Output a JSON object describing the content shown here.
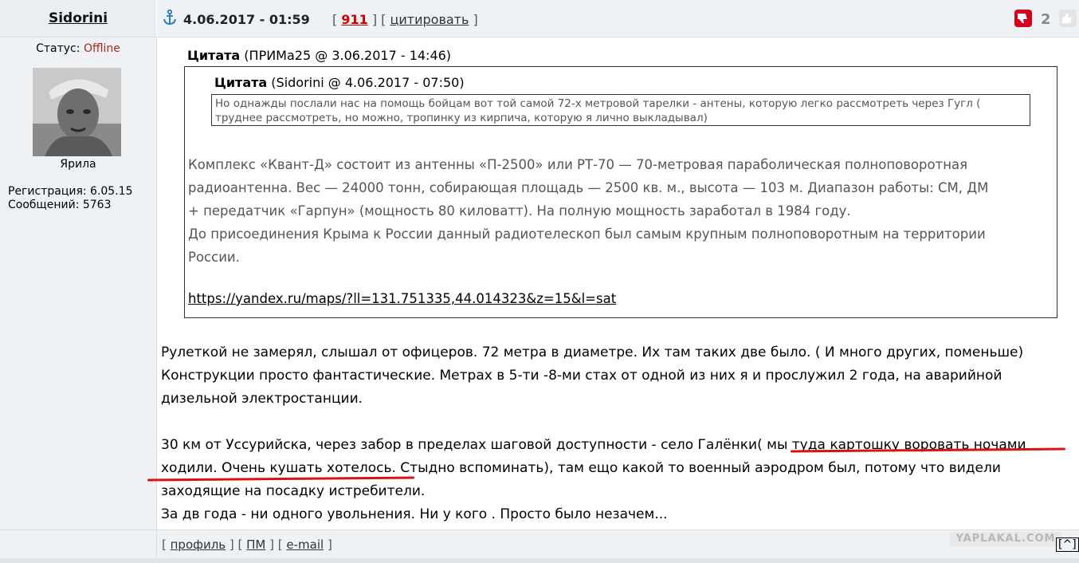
{
  "header": {
    "username": "Sidorini",
    "date": "4.06.2017 - 01:59",
    "bracket_open": "[ ",
    "post_number": "911",
    "bracket_mid": " ] [ ",
    "cite_label": "цитировать",
    "bracket_close": " ]",
    "rating": "2"
  },
  "sidebar": {
    "status_label": "Статус: ",
    "status_value": "Offline",
    "avatar_caption": "Ярила",
    "registration": "Регистрация: 6.05.15",
    "messages": "Сообщений: 5763"
  },
  "quote_outer": {
    "label": "Цитата",
    "meta": " (ПРИМа25 @ 3.06.2017 - 14:46)",
    "text_lines": [
      "Комплекс «Квант-Д» состоит из антенны «П-2500» или РТ-70 — 70-метровая параболическая полноповоротная",
      "радиоантенна. Вес — 24000 тонн, собирающая площадь — 2500 кв. м., высота — 103 м. Диапазон работы: СМ, ДМ",
      "+ передатчик «Гарпун» (мощность 80 киловатт). На полную мощность заработал в 1984 году.",
      "До присоединения Крыма к России данный радиотелескоп был самым крупным полноповоротным на территории",
      "России."
    ],
    "link": "https://yandex.ru/maps/?ll=131.751335,44.014323&z=15&l=sat"
  },
  "quote_inner": {
    "label": "Цитата",
    "meta": " (Sidorini @ 4.06.2017 - 07:50)",
    "text": "Но однажды послали нас на помощь бойцам вот той самой 72-х метровой тарелки - антены, которую легко рассмотреть через Гугл ( труднее рассмотреть, но можно, тропинку из кирпича, которую я лично выкладывал)"
  },
  "post": {
    "p1_lines": [
      "Рулеткой не замерял, слышал от офицеров. 72 метра в диаметре. Их там таких две было. ( И много других, поменьше)",
      "Конструкции просто фантастические. Метрах в 5-ти -8-ми стах от одной из них я и прослужил 2 года, на аварийной",
      "дизельной электростанции."
    ],
    "p2_lines": [
      "30 км от Уссурийска, через забор в пределах шаговой доступности - село Галёнки( мы туда картошку воровать ночами",
      "ходили. Очень кушать хотелось. Стыдно вспоминать), там ещо какой то военный аэродром был, потому что видели",
      "заходящие на посадку истребители."
    ],
    "p3": "За дв года - ни одного увольнения. Ни у кого . Просто было незачем..."
  },
  "footer": {
    "profile": "профиль",
    "pm": "ПМ",
    "email": "e-mail",
    "watermark": "YAPLAKAL.COM",
    "to_top": "[^]"
  },
  "colors": {
    "accent_red": "#d9001b",
    "underline_red": "#dd1111",
    "offline": "#b5241b",
    "panel_bg": "#eef2f5"
  }
}
